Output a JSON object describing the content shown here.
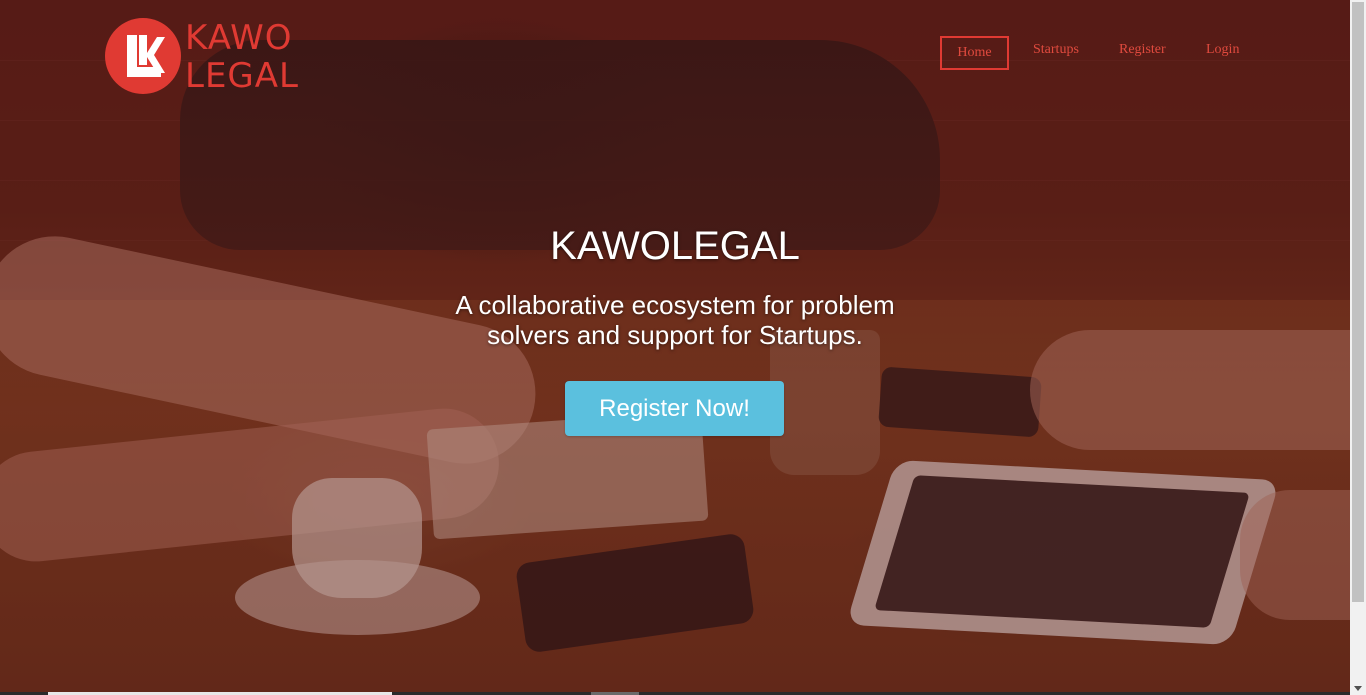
{
  "logo": {
    "line1": "KAWO",
    "line2": "LEGAL",
    "color": "#e03a33"
  },
  "nav": {
    "items": [
      {
        "label": "Home",
        "active": true
      },
      {
        "label": "Startups"
      },
      {
        "label": "Register"
      },
      {
        "label": "Login"
      }
    ]
  },
  "hero": {
    "title": "KAWOLEGAL",
    "subtitle": "A collaborative ecosystem for problem solvers and support for Startups.",
    "cta_label": "Register Now!",
    "cta_color": "#5bc0de"
  }
}
